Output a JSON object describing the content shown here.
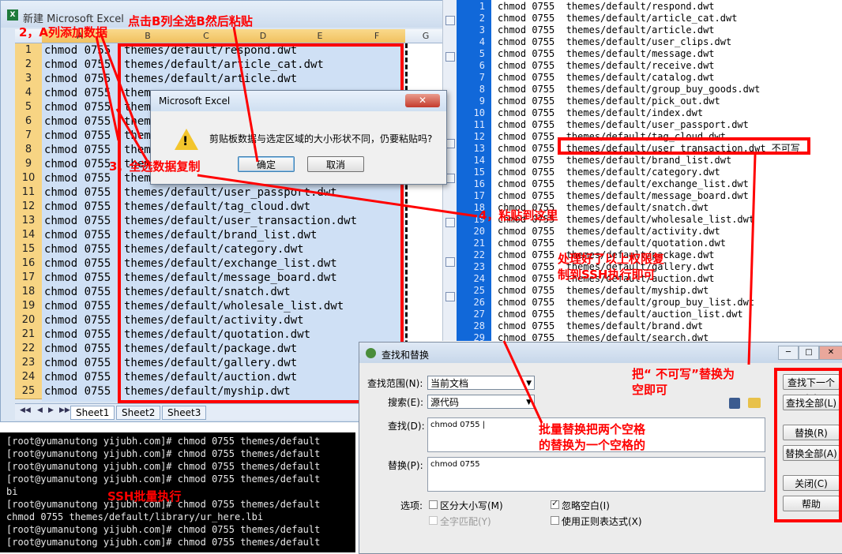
{
  "excel": {
    "title": "新建 Microsoft Excel",
    "columns": [
      "A",
      "B",
      "C",
      "D",
      "E",
      "F",
      "G"
    ],
    "rows": [
      {
        "n": "1",
        "a": "chmod 0755",
        "b": "themes/default/respond.dwt"
      },
      {
        "n": "2",
        "a": "chmod 0755",
        "b": "themes/default/article_cat.dwt"
      },
      {
        "n": "3",
        "a": "chmod 0755",
        "b": "themes/default/article.dwt"
      },
      {
        "n": "4",
        "a": "chmod 0755",
        "b": "them"
      },
      {
        "n": "5",
        "a": "chmod 0755",
        "b": "them"
      },
      {
        "n": "6",
        "a": "chmod 0755",
        "b": "them"
      },
      {
        "n": "7",
        "a": "chmod 0755",
        "b": "them"
      },
      {
        "n": "8",
        "a": "chmod 0755",
        "b": "them"
      },
      {
        "n": "9",
        "a": "chmod 0755",
        "b": "them"
      },
      {
        "n": "10",
        "a": "chmod 0755",
        "b": "them"
      },
      {
        "n": "11",
        "a": "chmod 0755",
        "b": "themes/default/user_passport.dwt"
      },
      {
        "n": "12",
        "a": "chmod 0755",
        "b": "themes/default/tag_cloud.dwt"
      },
      {
        "n": "13",
        "a": "chmod 0755",
        "b": "themes/default/user_transaction.dwt"
      },
      {
        "n": "14",
        "a": "chmod 0755",
        "b": "themes/default/brand_list.dwt"
      },
      {
        "n": "15",
        "a": "chmod 0755",
        "b": "themes/default/category.dwt"
      },
      {
        "n": "16",
        "a": "chmod 0755",
        "b": "themes/default/exchange_list.dwt"
      },
      {
        "n": "17",
        "a": "chmod 0755",
        "b": "themes/default/message_board.dwt"
      },
      {
        "n": "18",
        "a": "chmod 0755",
        "b": "themes/default/snatch.dwt"
      },
      {
        "n": "19",
        "a": "chmod 0755",
        "b": "themes/default/wholesale_list.dwt"
      },
      {
        "n": "20",
        "a": "chmod 0755",
        "b": "themes/default/activity.dwt"
      },
      {
        "n": "21",
        "a": "chmod 0755",
        "b": "themes/default/quotation.dwt"
      },
      {
        "n": "22",
        "a": "chmod 0755",
        "b": "themes/default/package.dwt"
      },
      {
        "n": "23",
        "a": "chmod 0755",
        "b": "themes/default/gallery.dwt"
      },
      {
        "n": "24",
        "a": "chmod 0755",
        "b": "themes/default/auction.dwt"
      },
      {
        "n": "25",
        "a": "chmod 0755",
        "b": "themes/default/myship.dwt"
      }
    ],
    "sheets": [
      "Sheet1",
      "Sheet2",
      "Sheet3"
    ]
  },
  "excel_dialog": {
    "title": "Microsoft Excel",
    "close": "✕",
    "message": "剪贴板数据与选定区域的大小形状不同，仍要粘贴吗?",
    "ok": "确定",
    "cancel": "取消"
  },
  "editor": {
    "lines": [
      {
        "n": "1",
        "t": "chmod 0755  themes/default/respond.dwt"
      },
      {
        "n": "2",
        "t": "chmod 0755  themes/default/article_cat.dwt"
      },
      {
        "n": "3",
        "t": "chmod 0755  themes/default/article.dwt"
      },
      {
        "n": "4",
        "t": "chmod 0755  themes/default/user_clips.dwt"
      },
      {
        "n": "5",
        "t": "chmod 0755  themes/default/message.dwt"
      },
      {
        "n": "6",
        "t": "chmod 0755  themes/default/receive.dwt"
      },
      {
        "n": "7",
        "t": "chmod 0755  themes/default/catalog.dwt"
      },
      {
        "n": "8",
        "t": "chmod 0755  themes/default/group_buy_goods.dwt"
      },
      {
        "n": "9",
        "t": "chmod 0755  themes/default/pick_out.dwt"
      },
      {
        "n": "10",
        "t": "chmod 0755  themes/default/index.dwt"
      },
      {
        "n": "11",
        "t": "chmod 0755  themes/default/user_passport.dwt"
      },
      {
        "n": "12",
        "t": "chmod 0755  themes/default/tag_cloud.dwt"
      },
      {
        "n": "13",
        "t": "chmod 0755  themes/default/user_transaction.dwt 不可写"
      },
      {
        "n": "14",
        "t": "chmod 0755  themes/default/brand_list.dwt"
      },
      {
        "n": "15",
        "t": "chmod 0755  themes/default/category.dwt"
      },
      {
        "n": "16",
        "t": "chmod 0755  themes/default/exchange_list.dwt"
      },
      {
        "n": "17",
        "t": "chmod 0755  themes/default/message_board.dwt"
      },
      {
        "n": "18",
        "t": "chmod 0755  themes/default/snatch.dwt"
      },
      {
        "n": "19",
        "t": "chmod 0755  themes/default/wholesale_list.dwt"
      },
      {
        "n": "20",
        "t": "chmod 0755  themes/default/activity.dwt"
      },
      {
        "n": "21",
        "t": "chmod 0755  themes/default/quotation.dwt"
      },
      {
        "n": "22",
        "t": "chmod 0755  themes/default/package.dwt"
      },
      {
        "n": "23",
        "t": "chmod 0755  themes/default/gallery.dwt"
      },
      {
        "n": "24",
        "t": "chmod 0755  themes/default/auction.dwt"
      },
      {
        "n": "25",
        "t": "chmod 0755  themes/default/myship.dwt"
      },
      {
        "n": "26",
        "t": "chmod 0755  themes/default/group_buy_list.dwt"
      },
      {
        "n": "27",
        "t": "chmod 0755  themes/default/auction_list.dwt"
      },
      {
        "n": "28",
        "t": "chmod 0755  themes/default/brand.dwt"
      },
      {
        "n": "29",
        "t": "chmod 0755  themes/default/search.dwt"
      }
    ]
  },
  "terminal": {
    "lines": [
      "[root@yumanutong yijubh.com]# chmod 0755 themes/default",
      "[root@yumanutong yijubh.com]# chmod 0755 themes/default",
      "[root@yumanutong yijubh.com]# chmod 0755 themes/default",
      "[root@yumanutong yijubh.com]# chmod 0755 themes/default",
      "bi",
      "[root@yumanutong yijubh.com]# chmod 0755 themes/default",
      "chmod 0755 themes/default/library/ur_here.lbi",
      "[root@yumanutong yijubh.com]# chmod 0755 themes/default",
      "[root@yumanutong yijubh.com]# chmod 0755 themes/default"
    ]
  },
  "find": {
    "title": "查找和替换",
    "scope_label": "查找范围(N):",
    "scope_value": "当前文档",
    "search_label": "搜索(E):",
    "search_value": "源代码",
    "find_label": "查找(D):",
    "find_value": "chmod 0755  |",
    "replace_label": "替换(P):",
    "replace_value": "chmod 0755",
    "options_label": "选项:",
    "opt_case": "区分大小写(M)",
    "opt_ignore_ws": "忽略空白(I)",
    "opt_whole": "全字匹配(Y)",
    "opt_regex": "使用正则表达式(X)",
    "btn_find_next": "查找下一个(F)",
    "btn_find_all": "查找全部(L)",
    "btn_replace": "替换(R)",
    "btn_replace_all": "替换全部(A)",
    "btn_close": "关闭(C)",
    "btn_help": "帮助"
  },
  "annotations": {
    "a1": "点击B列全选B然后粘贴",
    "a2": "2，A列添加数据",
    "a3": "3，全选数据复制",
    "a4": "4，粘贴到这里",
    "a5": "处理好了以上权限复\n制到SSH执行即可",
    "a6": "SSH批量执行",
    "a7": "把“ 不可写”替换为\n空即可",
    "a8": "批量替换把两个空格\n的替换为一个空格的"
  }
}
